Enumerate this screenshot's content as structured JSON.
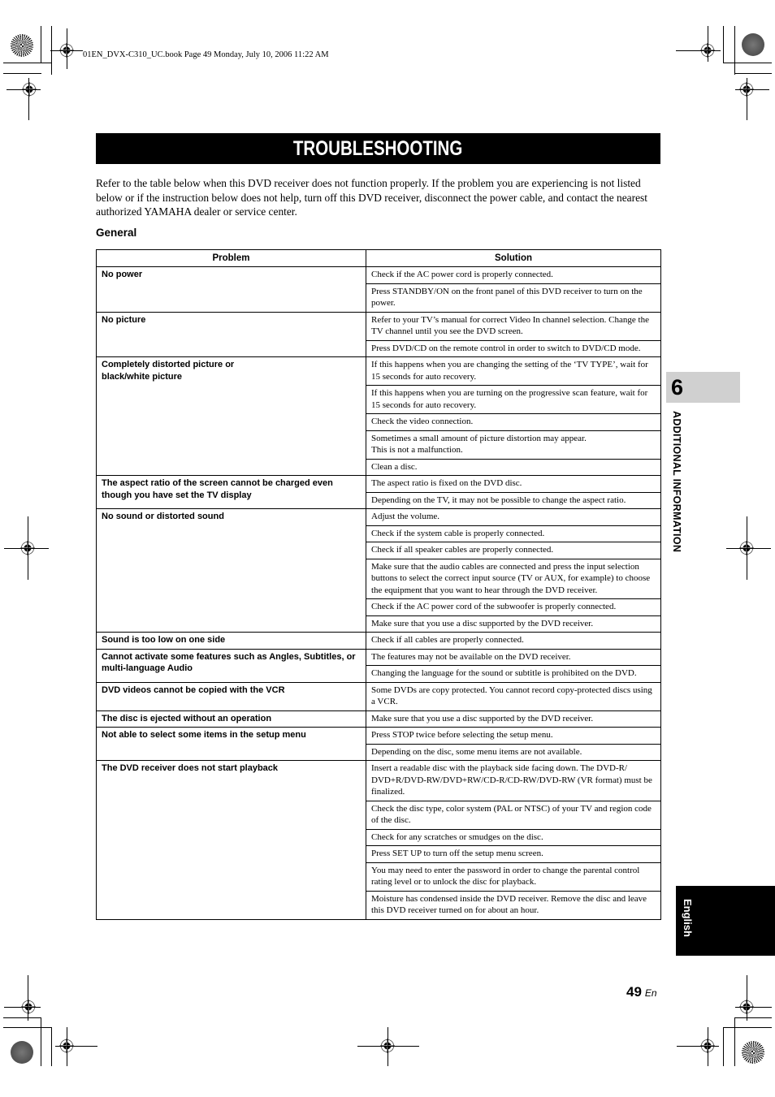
{
  "header": {
    "book_line": "01EN_DVX-C310_UC.book  Page 49  Monday, July 10, 2006  11:22 AM"
  },
  "page": {
    "title": "TROUBLESHOOTING",
    "intro": "Refer to the table below when this DVD receiver does not function properly. If the problem you are experiencing is not listed below or if the instruction below does not help, turn off this DVD receiver, disconnect the power cable, and contact the nearest authorized YAMAHA dealer or service center.",
    "section_heading": "General"
  },
  "table": {
    "headers": {
      "problem": "Problem",
      "solution": "Solution"
    },
    "rows": [
      {
        "problem": "No power",
        "solutions": [
          "Check if the AC power cord is properly connected.",
          "Press STANDBY/ON on the front panel of this DVD receiver to turn on the power."
        ]
      },
      {
        "problem": "No picture",
        "solutions": [
          "Refer to your TV’s manual for correct Video In channel selection. Change the TV channel until you see the DVD screen.",
          "Press DVD/CD on the remote control in order to switch to DVD/CD mode."
        ]
      },
      {
        "problem": "Completely distorted picture or\nblack/white picture",
        "solutions": [
          "If this happens when you are changing the setting of the ‘TV TYPE’, wait for 15 seconds for auto recovery.",
          "If this happens when you are turning on the progressive scan feature, wait for 15 seconds for auto recovery.",
          "Check the video connection.",
          "Sometimes a small amount of picture distortion may appear.\nThis is not a malfunction.",
          "Clean a disc."
        ]
      },
      {
        "problem": "The aspect ratio of the screen cannot be charged even though you have set the TV display",
        "solutions": [
          "The aspect ratio is fixed on the DVD disc.",
          "Depending on the TV, it may not be possible to change the aspect ratio."
        ]
      },
      {
        "problem": "No sound or distorted sound",
        "solutions": [
          "Adjust the volume.",
          "Check if the system cable is properly connected.",
          "Check if all speaker cables are properly connected.",
          "Make sure that the audio cables are connected and press the input selection buttons to select the correct input source (TV or AUX, for example) to choose the equipment that you want to hear through the DVD receiver.",
          "Check if the AC power cord of the subwoofer is properly connected.",
          "Make sure that you use a disc supported by the DVD receiver."
        ]
      },
      {
        "problem": "Sound is too low on one side",
        "solutions": [
          "Check if all cables are properly connected."
        ]
      },
      {
        "problem": "Cannot activate some features such as Angles, Subtitles, or multi-language Audio",
        "solutions": [
          "The features may not be available on the DVD receiver.",
          "Changing the language for the sound or subtitle is prohibited on the DVD."
        ]
      },
      {
        "problem": "DVD videos cannot be copied with the VCR",
        "solutions": [
          "Some DVDs are copy protected. You cannot record copy-protected discs using a VCR."
        ]
      },
      {
        "problem": "The disc is ejected without an operation",
        "solutions": [
          "Make sure that you use a disc supported by the DVD receiver."
        ]
      },
      {
        "problem": "Not able to select some items in the setup menu",
        "solutions": [
          "Press STOP twice before selecting the setup menu.",
          "Depending on the disc, some menu items are not available."
        ]
      },
      {
        "problem": "The DVD receiver does not start playback",
        "solutions": [
          "Insert a readable disc with the playback side facing down. The DVD-R/ DVD+R/DVD-RW/DVD+RW/CD-R/CD-RW/DVD-RW (VR format) must be finalized.",
          "Check the disc type, color system (PAL or NTSC) of your TV and region code of the disc.",
          "Check for any scratches or smudges on the disc.",
          "Press SET UP to turn off the setup menu screen.",
          "You may need to enter the password in order to change the parental control rating level or to unlock the disc for playback.",
          "Moisture has condensed inside the DVD receiver. Remove the disc and leave this DVD receiver turned on for about an hour."
        ]
      }
    ]
  },
  "side": {
    "chapter_number": "6",
    "chapter_label": "ADDITIONAL INFORMATION",
    "language_tab": "English"
  },
  "footer": {
    "page_number": "49",
    "page_suffix": "En"
  },
  "icons": {
    "registration_mark": "registration-mark-icon",
    "color_target": "color-target-icon"
  }
}
